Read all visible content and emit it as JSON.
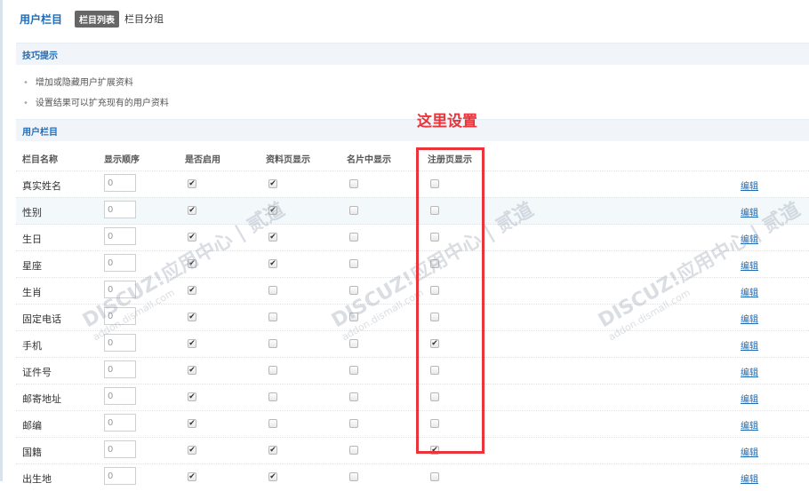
{
  "header": {
    "title": "用户栏目",
    "tabs": [
      "栏目列表",
      "栏目分组"
    ]
  },
  "tips": {
    "title": "技巧提示",
    "items": [
      "增加或隐藏用户扩展资料",
      "设置结果可以扩充现有的用户资料"
    ]
  },
  "section_title": "用户栏目",
  "columns": [
    "栏目名称",
    "显示顺序",
    "是否启用",
    "资料页显示",
    "名片中显示",
    "注册页显示"
  ],
  "edit_label": "编辑",
  "annotation": "这里设置",
  "watermark": {
    "main": "DISCUZ!应用中心 | 贰道",
    "sub": "addon.dismall.com"
  },
  "colors": {
    "accent": "#1e6bb8",
    "annotation": "#e8343a"
  },
  "rows": [
    {
      "name": "真实姓名",
      "order": "0",
      "enabled": true,
      "profile": true,
      "card": false,
      "register": false
    },
    {
      "name": "性别",
      "order": "0",
      "enabled": true,
      "profile": true,
      "card": false,
      "register": false
    },
    {
      "name": "生日",
      "order": "0",
      "enabled": true,
      "profile": true,
      "card": false,
      "register": false
    },
    {
      "name": "星座",
      "order": "0",
      "enabled": true,
      "profile": true,
      "card": false,
      "register": false
    },
    {
      "name": "生肖",
      "order": "0",
      "enabled": true,
      "profile": false,
      "card": false,
      "register": false
    },
    {
      "name": "固定电话",
      "order": "0",
      "enabled": true,
      "profile": false,
      "card": false,
      "register": false
    },
    {
      "name": "手机",
      "order": "0",
      "enabled": true,
      "profile": false,
      "card": false,
      "register": true
    },
    {
      "name": "证件号",
      "order": "0",
      "enabled": true,
      "profile": false,
      "card": false,
      "register": false
    },
    {
      "name": "邮寄地址",
      "order": "0",
      "enabled": true,
      "profile": false,
      "card": false,
      "register": false
    },
    {
      "name": "邮编",
      "order": "0",
      "enabled": true,
      "profile": false,
      "card": false,
      "register": false
    },
    {
      "name": "国籍",
      "order": "0",
      "enabled": true,
      "profile": true,
      "card": false,
      "register": true
    },
    {
      "name": "出生地",
      "order": "0",
      "enabled": true,
      "profile": true,
      "card": false,
      "register": false
    }
  ]
}
